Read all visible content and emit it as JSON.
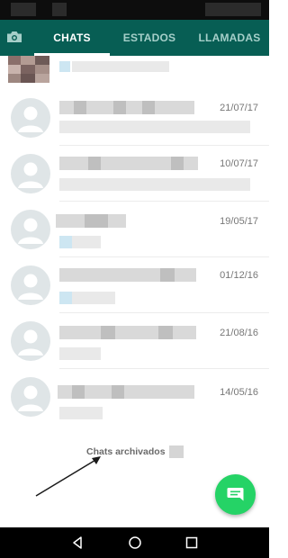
{
  "tabs": [
    {
      "label": "CHATS",
      "active": true
    },
    {
      "label": "ESTADOS",
      "active": false
    },
    {
      "label": "LLAMADAS",
      "active": false
    }
  ],
  "icons": {
    "camera": "camera-icon",
    "new_chat": "chat-bubble-icon",
    "nav_back": "back-triangle-icon",
    "nav_home": "home-circle-icon",
    "nav_recents": "recents-square-icon"
  },
  "chats": [
    {
      "date": "21/07/17"
    },
    {
      "date": "10/07/17"
    },
    {
      "date": "19/05/17"
    },
    {
      "date": "01/12/16"
    },
    {
      "date": "21/08/16"
    },
    {
      "date": "14/05/16"
    }
  ],
  "archived": {
    "label": "Chats archivados"
  },
  "colors": {
    "header": "#075e54",
    "accent_fab": "#25d366",
    "tab_inactive": "#a5cfc9"
  }
}
